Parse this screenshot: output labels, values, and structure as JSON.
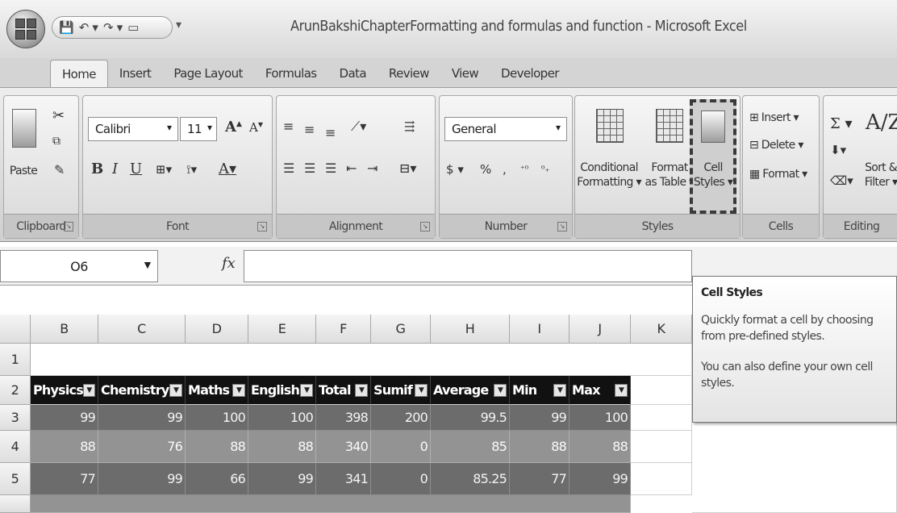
{
  "window": {
    "title": "ArunBakshiChapterFormatting and formulas and function - Microsoft Excel"
  },
  "qat": {
    "icons": [
      "save-icon",
      "undo-icon",
      "redo-icon",
      "new-icon",
      "customize-icon"
    ]
  },
  "tabs": [
    "Home",
    "Insert",
    "Page Layout",
    "Formulas",
    "Data",
    "Review",
    "View",
    "Developer"
  ],
  "ribbon": {
    "clipboard": {
      "paste_label": "Paste",
      "group_label": "Clipboard"
    },
    "font": {
      "family": "Calibri",
      "size": "11",
      "group_label": "Font"
    },
    "alignment": {
      "group_label": "Alignment"
    },
    "number": {
      "format": "General",
      "currency": "$",
      "percent": "%",
      "comma": ",",
      "group_label": "Number"
    },
    "styles": {
      "conditional_1": "Conditional",
      "conditional_2": "Formatting ▾",
      "format_table_1": "Format",
      "format_table_2": "as Table ▾",
      "cell_styles_1": "Cell",
      "cell_styles_2": "Styles ▾",
      "group_label": "Styles"
    },
    "cells": {
      "insert": "Insert ▾",
      "delete": "Delete ▾",
      "format": "Format ▾",
      "group_label": "Cells"
    },
    "editing": {
      "sort_1": "Sort &",
      "sort_2": "Filter ▾",
      "group_label": "Editing"
    }
  },
  "formula_bar": {
    "name_box": "O6",
    "fx": "fx",
    "formula": ""
  },
  "sheet": {
    "columns": [
      "B",
      "C",
      "D",
      "E",
      "F",
      "G",
      "H",
      "I",
      "J",
      "K"
    ],
    "rows": [
      "1",
      "2",
      "3",
      "4",
      "5"
    ],
    "headers": [
      "Physics",
      "Chemistry",
      "Maths",
      "English",
      "Total",
      "Sumif",
      "Average",
      "Min",
      "Max"
    ],
    "data": [
      [
        "99",
        "99",
        "100",
        "100",
        "398",
        "200",
        "99.5",
        "99",
        "100"
      ],
      [
        "88",
        "76",
        "88",
        "88",
        "340",
        "0",
        "85",
        "88",
        "88"
      ],
      [
        "77",
        "99",
        "66",
        "99",
        "341",
        "0",
        "85.25",
        "77",
        "99"
      ]
    ]
  },
  "tooltip": {
    "title": "Cell Styles",
    "line1": "Quickly format a cell by choosing",
    "line2": "from pre-defined styles.",
    "line3": "You can also define your own cell",
    "line4": "styles."
  }
}
